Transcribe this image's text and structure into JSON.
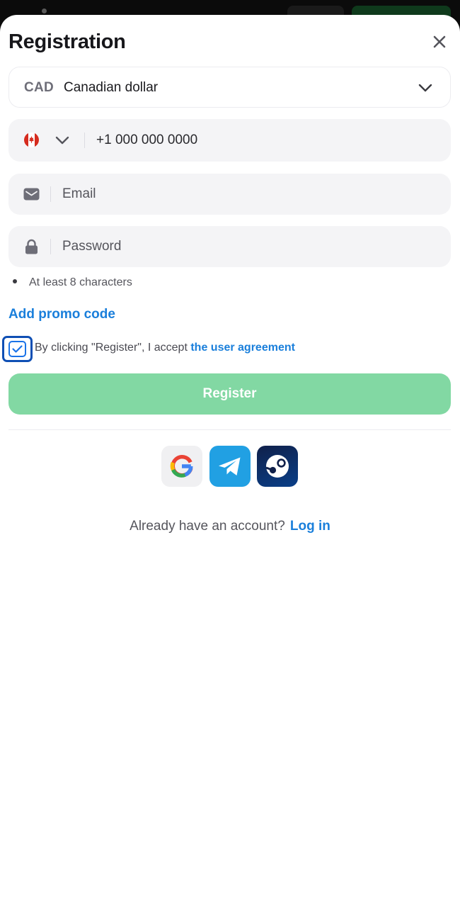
{
  "title": "Registration",
  "currency": {
    "code": "CAD",
    "name": "Canadian dollar"
  },
  "phone": {
    "country": "Canada",
    "placeholder": "+1 000 000 0000"
  },
  "email": {
    "placeholder": "Email"
  },
  "password": {
    "placeholder": "Password",
    "hint": "At least 8 characters"
  },
  "promo_label": "Add promo code",
  "agreement": {
    "text": "By clicking \"Register\", I accept",
    "link": "the user agreement",
    "checked": true
  },
  "register_label": "Register",
  "social": [
    {
      "name": "Google",
      "icon": "google-icon"
    },
    {
      "name": "Telegram",
      "icon": "telegram-icon"
    },
    {
      "name": "Steam",
      "icon": "steam-icon"
    }
  ],
  "login": {
    "prompt": "Already have an account?",
    "link": "Log in"
  },
  "colors": {
    "accent": "#1a7fdb",
    "register_button": "#82d8a3",
    "field_bg": "#f4f4f6",
    "focus_ring": "#0f4fb4"
  }
}
